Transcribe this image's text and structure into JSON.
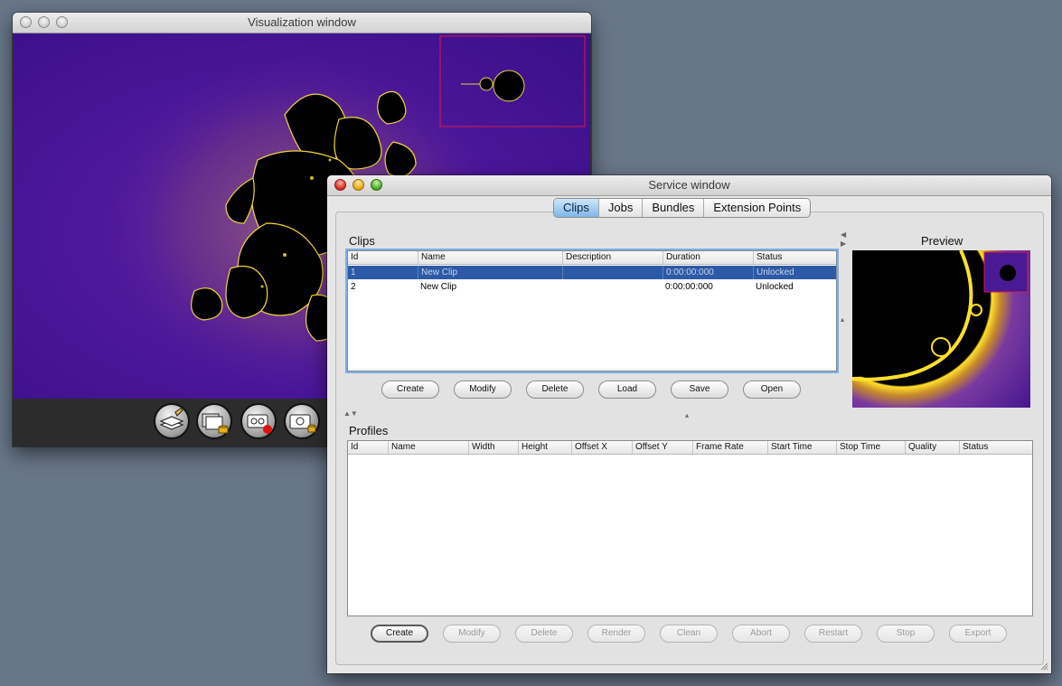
{
  "viz_window": {
    "title": "Visualization window",
    "toolbar": [
      {
        "icon": "edit-layers-icon"
      },
      {
        "icon": "image-stack-database-icon"
      },
      {
        "icon": "record-clip-icon"
      },
      {
        "icon": "camera-database-icon"
      }
    ]
  },
  "svc_window": {
    "title": "Service window",
    "tabs": [
      "Clips",
      "Jobs",
      "Bundles",
      "Extension Points"
    ],
    "active_tab": "Clips",
    "clips": {
      "label": "Clips",
      "columns": [
        "Id",
        "Name",
        "Description",
        "Duration",
        "Status"
      ],
      "rows": [
        {
          "id": "1",
          "name": "New Clip",
          "description": "",
          "duration": "0:00:00:000",
          "status": "Unlocked",
          "selected": true
        },
        {
          "id": "2",
          "name": "New Clip",
          "description": "",
          "duration": "0:00:00:000",
          "status": "Unlocked",
          "selected": false
        }
      ],
      "buttons": [
        "Create",
        "Modify",
        "Delete",
        "Load",
        "Save",
        "Open"
      ]
    },
    "preview": {
      "label": "Preview"
    },
    "profiles": {
      "label": "Profiles",
      "columns": [
        "Id",
        "Name",
        "Width",
        "Height",
        "Offset X",
        "Offset Y",
        "Frame Rate",
        "Start Time",
        "Stop Time",
        "Quality",
        "Status"
      ],
      "buttons": [
        "Create",
        "Modify",
        "Delete",
        "Render",
        "Clean",
        "Abort",
        "Restart",
        "Stop",
        "Export"
      ]
    }
  },
  "colors": {
    "desktop": "#687689",
    "fractal_bg": "#4b169a",
    "selection": "#2d5aa6",
    "tab_active": "#7fb6ec"
  }
}
